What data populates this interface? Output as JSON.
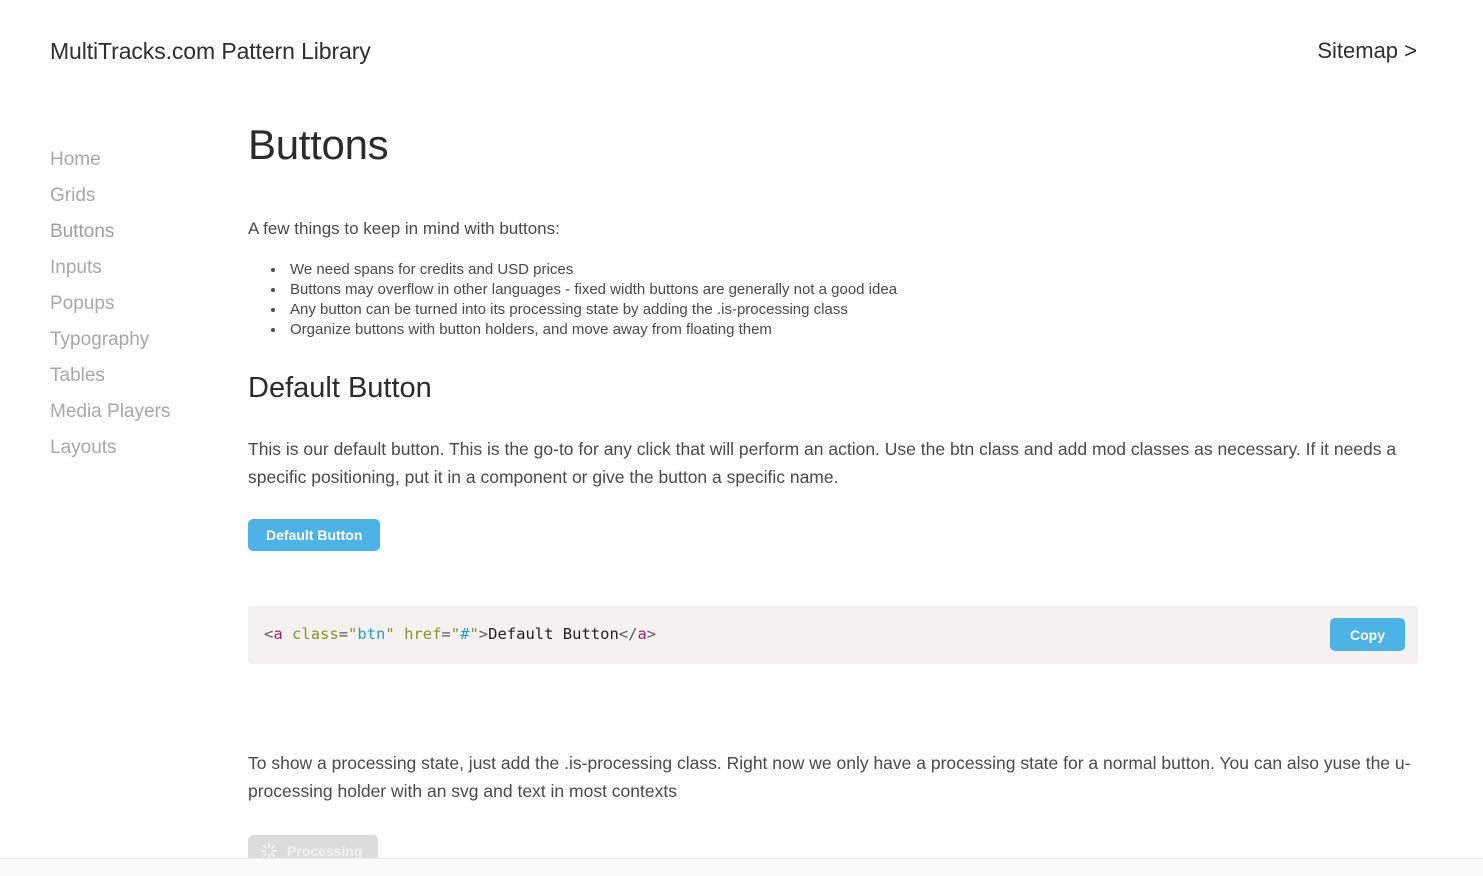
{
  "header": {
    "site_title": "MultiTracks.com Pattern Library",
    "sitemap_label": "Sitemap >"
  },
  "sidebar": {
    "items": [
      {
        "label": "Home",
        "active": false
      },
      {
        "label": "Grids",
        "active": false
      },
      {
        "label": "Buttons",
        "active": true
      },
      {
        "label": "Inputs",
        "active": false
      },
      {
        "label": "Popups",
        "active": false
      },
      {
        "label": "Typography",
        "active": false
      },
      {
        "label": "Tables",
        "active": false
      },
      {
        "label": "Media Players",
        "active": false
      },
      {
        "label": "Layouts",
        "active": false
      }
    ]
  },
  "main": {
    "page_title": "Buttons",
    "lead": "A few things to keep in mind with buttons:",
    "notes": [
      "We need spans for credits and USD prices",
      "Buttons may overflow in other languages - fixed width buttons are generally not a good idea",
      "Any button can be turned into its processing state by adding the .is-processing class",
      "Organize buttons with button holders, and move away from floating them"
    ],
    "section_title": "Default Button",
    "section_copy": "This is our default button. This is the go-to for any click that will perform an action. Use the btn class and add mod classes as necessary. If it needs a specific positioning, put it in a component or give the button a specific name.",
    "default_button_label": "Default Button",
    "code_snippet": {
      "full": "<a class=\"btn\" href=\"#\">Default Button</a>",
      "tokens": {
        "open_angle": "<",
        "tag_name": "a",
        "space1": " ",
        "attr_class": "class",
        "eq1": "=",
        "quote_open1": "\"",
        "val_btn": "btn",
        "quote_close1": "\"",
        "space2": " ",
        "attr_href": "href",
        "eq2": "=",
        "quote_open2": "\"",
        "val_hash": "#",
        "quote_close2": "\"",
        "close_angle": ">",
        "inner_text": "Default Button",
        "closing_tag_open": "</",
        "closing_tag_name": "a",
        "closing_tag_close": ">"
      }
    },
    "copy_button_label": "Copy",
    "processing_copy": "To show a processing state, just add the .is-processing class. Right now we only have a processing state for a normal button. You can also yuse the u-processing holder with an svg and text in most contexts",
    "processing_button_label": "Processing",
    "spinner_icon": "spinner-icon"
  },
  "colors": {
    "accent_blue": "#4db3e4",
    "processing_gray": "#dcdcdc",
    "code_bg": "#f6f1f1",
    "sidebar_text": "#a8a8a8",
    "body_text": "#4a4a4a",
    "heading_text": "#2b2b2b"
  }
}
